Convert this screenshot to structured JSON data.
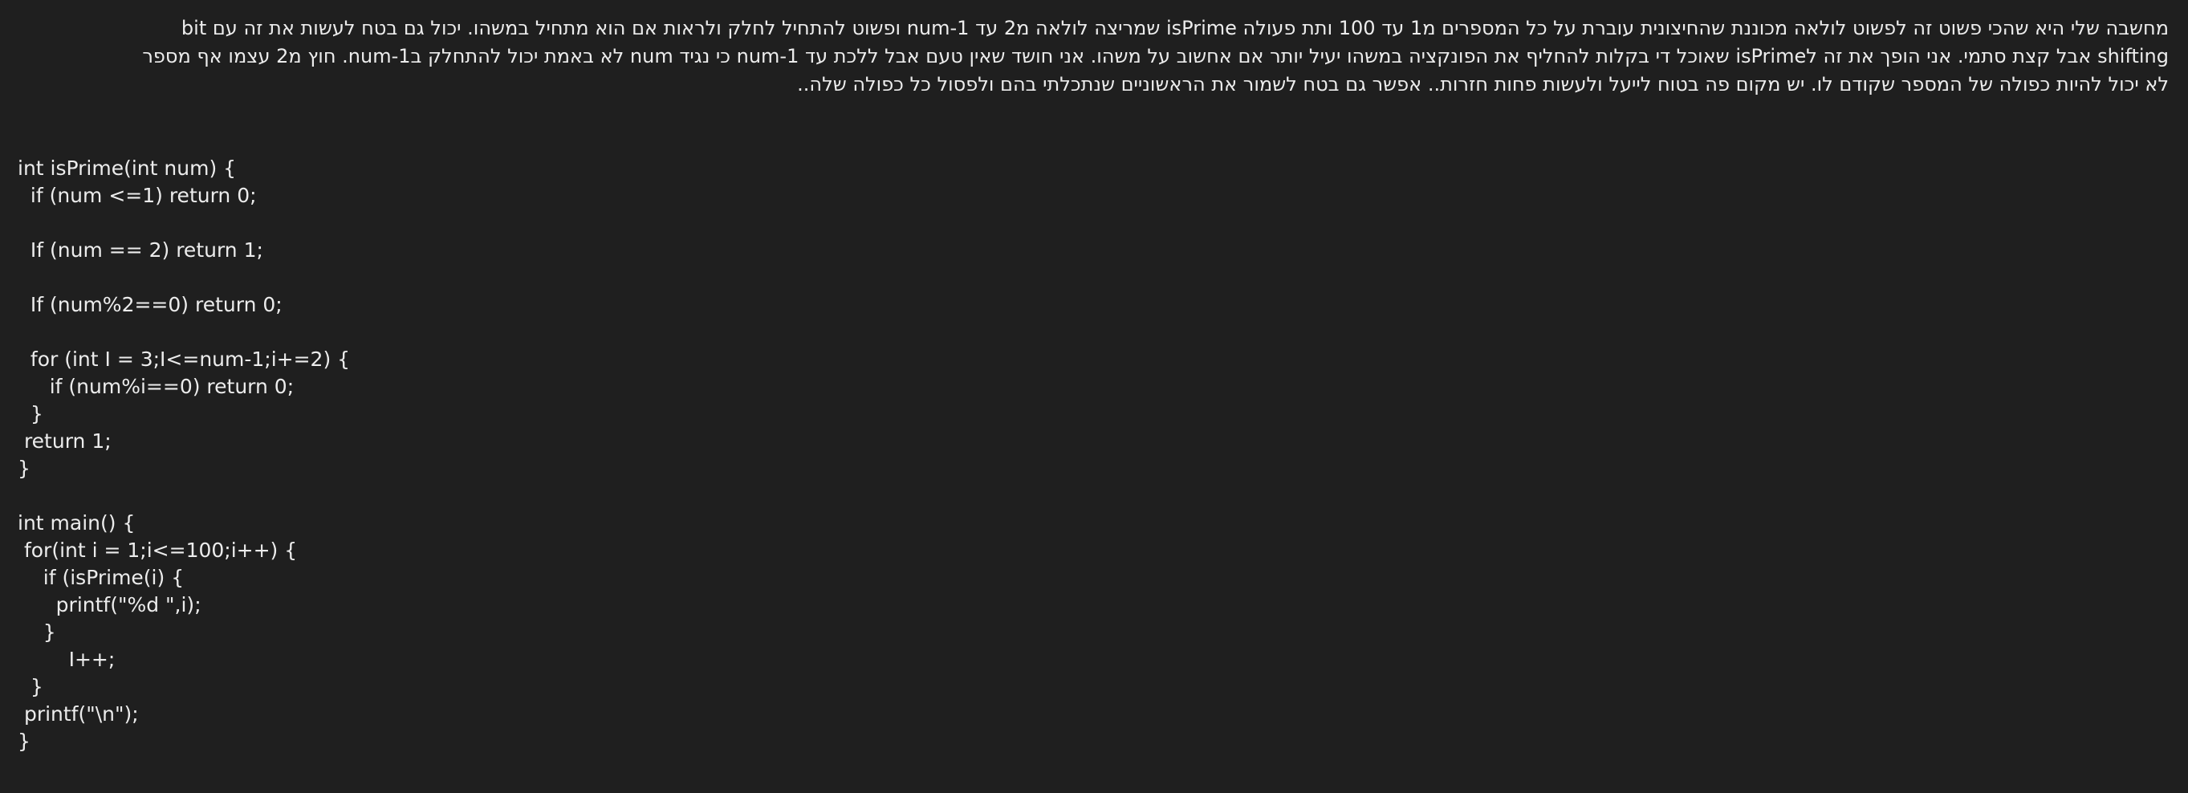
{
  "paragraph": {
    "lines": [
      "מחשבה שלי היא שהכי פשוט זה לפשוט לולאה מכוננת שהחיצונית עוברת על כל המספרים מ1 עד 100 ותת פעולה isPrime שמריצה לולאה מ2 עד num-1 ופשוט להתחיל לחלק ולראות אם הוא מתחיל במשהו. יכול גם בטח לעשות את זה עם bit",
      "shifting אבל קצת סתמי. אני הופך את זה לisPrime שאוכל די בקלות להחליף את הפונקציה במשהו יעיל יותר אם אחשוב על משהו. אני חושד שאין טעם אבל ללכת עד num-1 כי נגיד num לא באמת יכול להתחלק בnum-1. חוץ מ2 עצמו אף מספר",
      "לא יכול להיות כפולה של המספר שקודם לו. יש מקום פה בטוח לייעל ולעשות פחות חזרות..  אפשר גם בטח לשמור את הראשוניים שנתכלתי בהם ולפסול כל כפולה שלה.."
    ]
  },
  "code": {
    "lines": [
      "int isPrime(int num) {",
      "  if (num <=1) return 0;",
      "",
      "  If (num == 2) return 1;",
      "",
      "  If (num%2==0) return 0;",
      "",
      "  for (int I = 3;I<=num-1;i+=2) {",
      "     if (num%i==0) return 0;",
      "  }",
      " return 1;",
      "}",
      "",
      "int main() {",
      " for(int i = 1;i<=100;i++) {",
      "    if (isPrime(i) {",
      "      printf(\"%d \",i);",
      "    }",
      "        I++;",
      "  }",
      " printf(\"\\n\");",
      "}"
    ]
  }
}
